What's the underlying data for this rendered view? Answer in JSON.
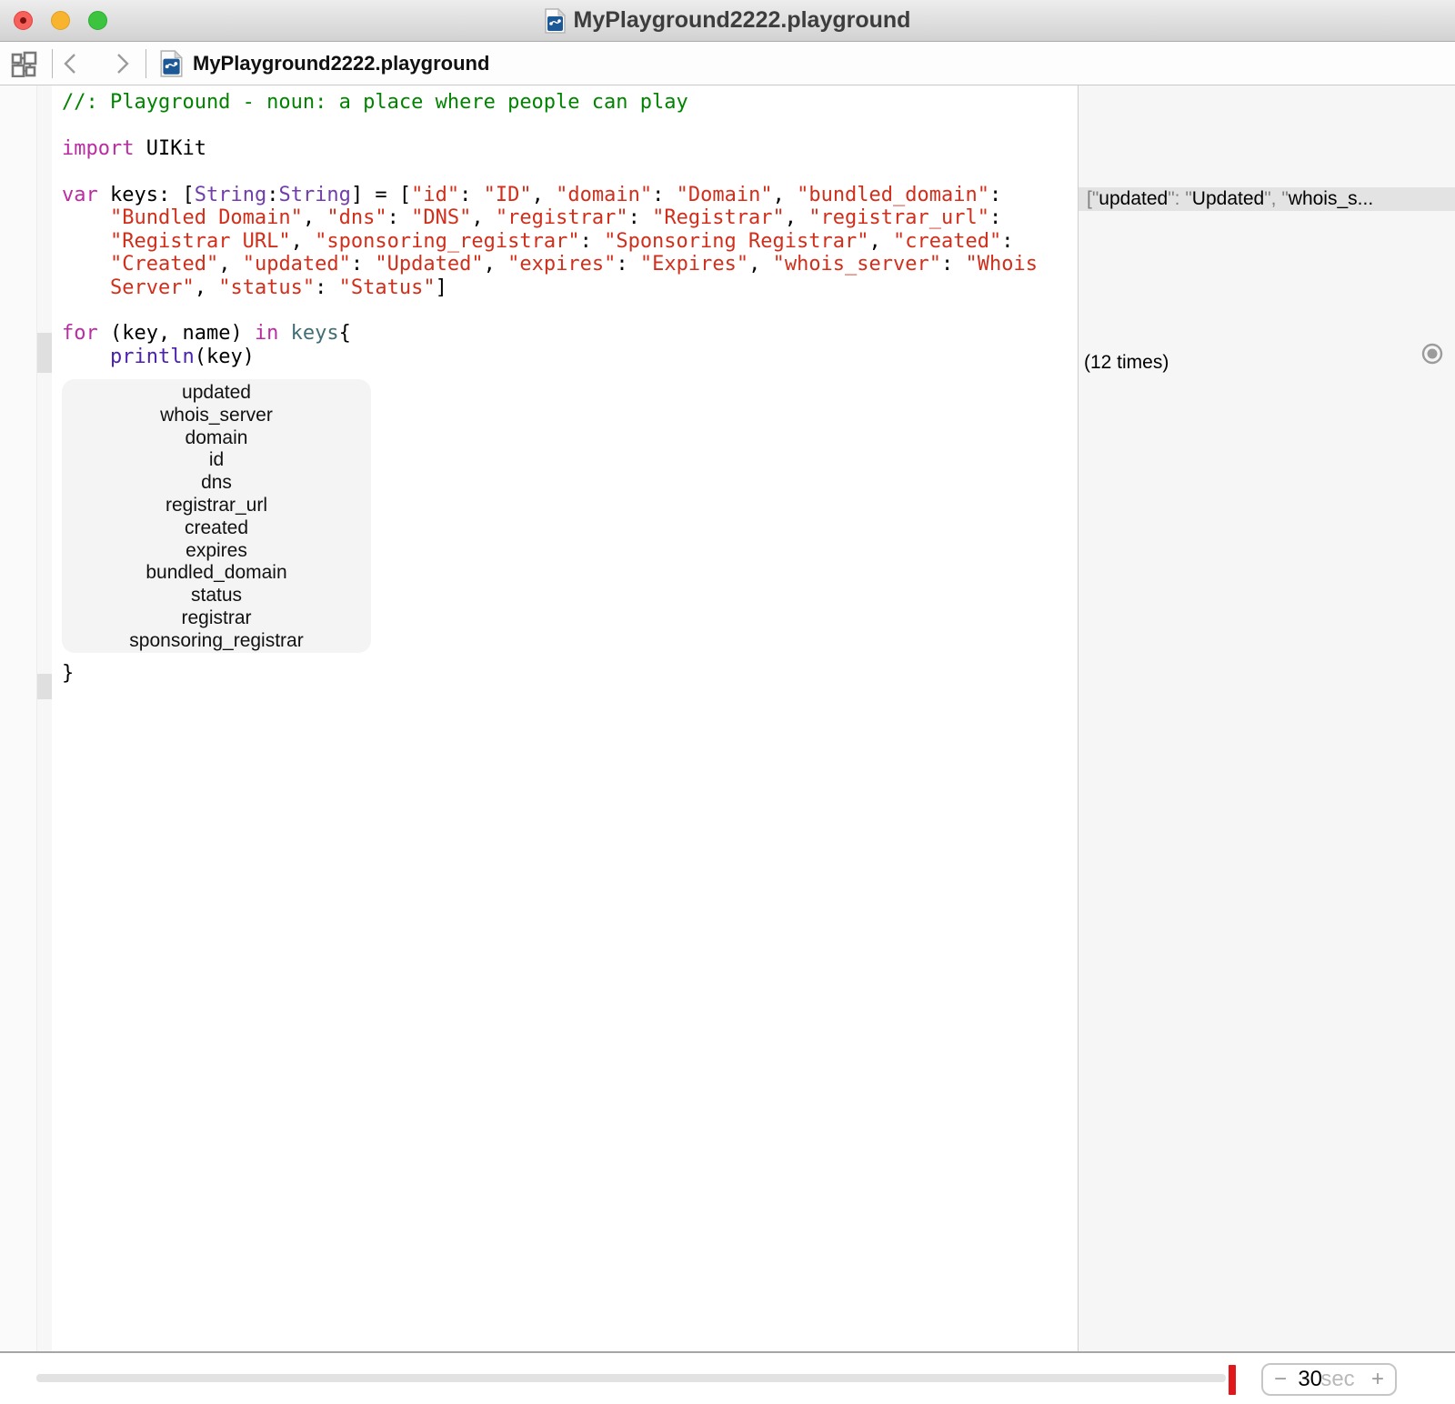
{
  "window": {
    "title": "MyPlayground2222.playground"
  },
  "jumpbar": {
    "filename": "MyPlayground2222.playground"
  },
  "editor": {
    "closing_brace": "}",
    "lines": [
      {
        "tokens": [
          [
            "cmt",
            "//: Playground - noun: a place where people can play"
          ]
        ]
      },
      {
        "tokens": []
      },
      {
        "tokens": [
          [
            "kw",
            "import"
          ],
          [
            "plain",
            " UIKit"
          ]
        ]
      },
      {
        "tokens": []
      },
      {
        "tokens": [
          [
            "kw",
            "var"
          ],
          [
            "plain",
            " keys: ["
          ],
          [
            "type",
            "String"
          ],
          [
            "plain",
            ":"
          ],
          [
            "type",
            "String"
          ],
          [
            "plain",
            "] = ["
          ],
          [
            "str",
            "\"id\""
          ],
          [
            "plain",
            ": "
          ],
          [
            "str",
            "\"ID\""
          ],
          [
            "plain",
            ", "
          ],
          [
            "str",
            "\"domain\""
          ],
          [
            "plain",
            ": "
          ],
          [
            "str",
            "\"Domain\""
          ],
          [
            "plain",
            ", "
          ],
          [
            "str",
            "\"bundled_domain\""
          ],
          [
            "plain",
            ":"
          ]
        ]
      },
      {
        "tokens": [
          [
            "plain",
            "    "
          ],
          [
            "str",
            "\"Bundled Domain\""
          ],
          [
            "plain",
            ", "
          ],
          [
            "str",
            "\"dns\""
          ],
          [
            "plain",
            ": "
          ],
          [
            "str",
            "\"DNS\""
          ],
          [
            "plain",
            ", "
          ],
          [
            "str",
            "\"registrar\""
          ],
          [
            "plain",
            ": "
          ],
          [
            "str",
            "\"Registrar\""
          ],
          [
            "plain",
            ", "
          ],
          [
            "str",
            "\"registrar_url\""
          ],
          [
            "plain",
            ":"
          ]
        ]
      },
      {
        "tokens": [
          [
            "plain",
            "    "
          ],
          [
            "str",
            "\"Registrar URL\""
          ],
          [
            "plain",
            ", "
          ],
          [
            "str",
            "\"sponsoring_registrar\""
          ],
          [
            "plain",
            ": "
          ],
          [
            "str",
            "\"Sponsoring Registrar\""
          ],
          [
            "plain",
            ", "
          ],
          [
            "str",
            "\"created\""
          ],
          [
            "plain",
            ":"
          ]
        ]
      },
      {
        "tokens": [
          [
            "plain",
            "    "
          ],
          [
            "str",
            "\"Created\""
          ],
          [
            "plain",
            ", "
          ],
          [
            "str",
            "\"updated\""
          ],
          [
            "plain",
            ": "
          ],
          [
            "str",
            "\"Updated\""
          ],
          [
            "plain",
            ", "
          ],
          [
            "str",
            "\"expires\""
          ],
          [
            "plain",
            ": "
          ],
          [
            "str",
            "\"Expires\""
          ],
          [
            "plain",
            ", "
          ],
          [
            "str",
            "\"whois_server\""
          ],
          [
            "plain",
            ": "
          ],
          [
            "str",
            "\"Whois"
          ]
        ]
      },
      {
        "tokens": [
          [
            "plain",
            "    "
          ],
          [
            "str",
            "Server\""
          ],
          [
            "plain",
            ", "
          ],
          [
            "str",
            "\"status\""
          ],
          [
            "plain",
            ": "
          ],
          [
            "str",
            "\"Status\""
          ],
          [
            "plain",
            "]"
          ]
        ]
      },
      {
        "tokens": []
      },
      {
        "tokens": [
          [
            "kw",
            "for"
          ],
          [
            "plain",
            " (key, name) "
          ],
          [
            "kw",
            "in"
          ],
          [
            "var",
            " keys"
          ],
          [
            "plain",
            "{"
          ]
        ]
      },
      {
        "tokens": [
          [
            "plain",
            "    "
          ],
          [
            "fn",
            "println"
          ],
          [
            "plain",
            "(key)"
          ]
        ]
      }
    ],
    "result_popup": {
      "items": [
        "updated",
        "whois_server",
        "domain",
        "id",
        "dns",
        "registrar_url",
        "created",
        "expires",
        "bundled_domain",
        "status",
        "registrar",
        "sponsoring_registrar"
      ]
    }
  },
  "sidebar": {
    "result_preview_tokens": [
      [
        "dim",
        "[\""
      ],
      [
        "dark",
        "updated"
      ],
      [
        "dim",
        "\": \""
      ],
      [
        "dark",
        "Updated"
      ],
      [
        "dim",
        "\", \""
      ],
      [
        "dark",
        "whois_s..."
      ]
    ],
    "loop_count": "(12 times)"
  },
  "bottombar": {
    "timer": {
      "minus": "−",
      "value": "30",
      "unit": "sec",
      "plus": "+"
    }
  }
}
